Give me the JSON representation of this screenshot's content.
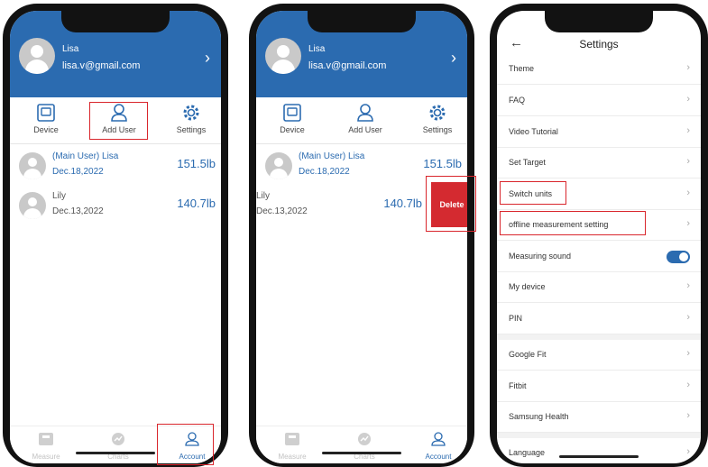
{
  "profile": {
    "name": "Lisa",
    "email": "lisa.v@gmail.com"
  },
  "toolbar": {
    "device": "Device",
    "add_user": "Add User",
    "settings": "Settings"
  },
  "users": [
    {
      "name": "(Main User) Lisa",
      "date": "Dec.18,2022",
      "weight": "151.5lb"
    },
    {
      "name": "Lily",
      "date": "Dec.13,2022",
      "weight": "140.7lb"
    }
  ],
  "swipe_action": {
    "delete": "Delete"
  },
  "tabs": {
    "measure": "Measure",
    "charts": "Charts",
    "account": "Account"
  },
  "settings": {
    "title": "Settings",
    "items_group1": [
      "Theme",
      "FAQ",
      "Video Tutorial",
      "Set Target",
      "Switch units",
      "offline measurement setting",
      "Measuring sound",
      "My device",
      "PIN"
    ],
    "items_group2": [
      "Google Fit",
      "Fitbit",
      "Samsung Health"
    ],
    "items_group3": [
      "Language"
    ],
    "measuring_sound_on": true
  },
  "colors": {
    "primary": "#2b6bb0",
    "highlight": "#d9262c",
    "delete": "#d42a30"
  }
}
